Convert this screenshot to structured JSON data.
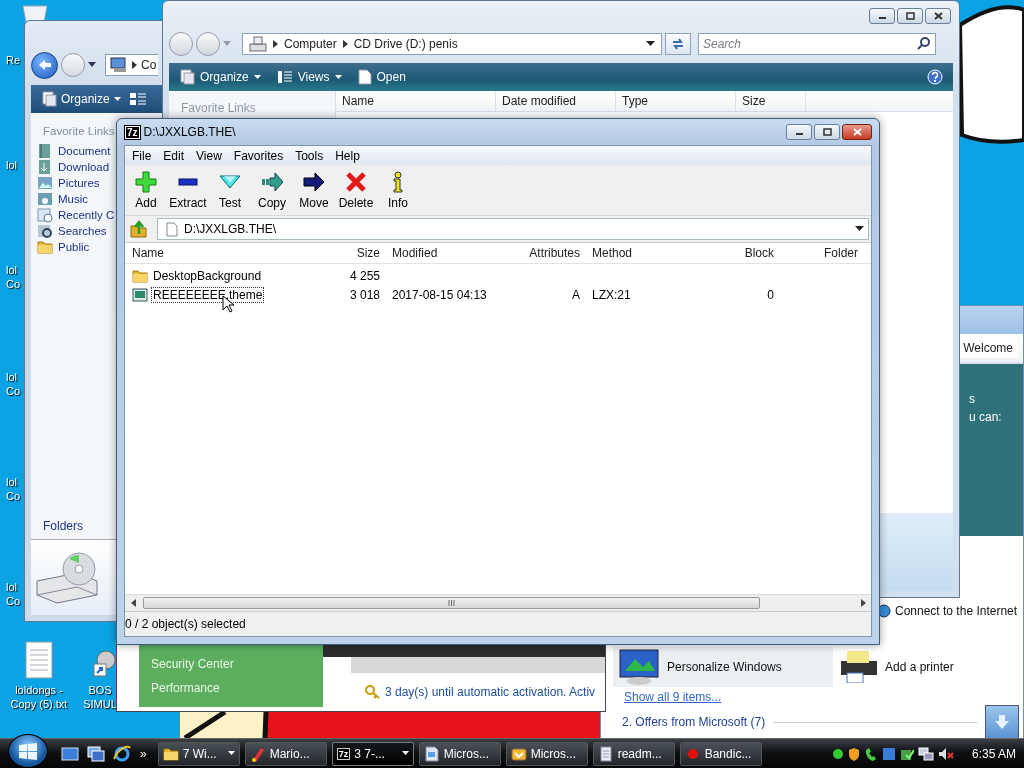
{
  "desktop_icons": [
    {
      "kind": "bin",
      "lines": [
        "Re"
      ]
    },
    {
      "kind": "covered",
      "lines": [
        "lol"
      ]
    },
    {
      "kind": "covered",
      "lines": [
        "lol",
        "Co"
      ]
    },
    {
      "kind": "covered",
      "lines": [
        "lol",
        "Co"
      ]
    },
    {
      "kind": "covered",
      "lines": [
        "lol",
        "Co"
      ]
    },
    {
      "kind": "covered",
      "lines": [
        "lol",
        "Co"
      ]
    },
    {
      "kind": "text-file",
      "lines": [
        "loldongs -",
        "Copy (5).txt"
      ]
    },
    {
      "kind": "shortcut",
      "lines": [
        "BOS",
        "SIMUL"
      ]
    }
  ],
  "welcome_center": {
    "tab": "Welcome",
    "intro": [
      "s",
      "u can:"
    ],
    "tasks": [
      {
        "kind": "internet",
        "label": "Connect to the Internet"
      },
      {
        "kind": "personalize",
        "label": "Personalize Windows"
      },
      {
        "kind": "printer",
        "label": "Add a printer"
      }
    ],
    "show_all": "Show all 9 items...",
    "section": "2. Offers from Microsoft (7)"
  },
  "control_panel": {
    "items": [
      "Security Center",
      "Performance"
    ],
    "activation": "3 day(s) until automatic activation. Activ"
  },
  "back_explorer": {
    "address": "Co",
    "toolbar": [
      "Organize"
    ],
    "favorites_title": "Favorite Links",
    "links": [
      {
        "kind": "documents",
        "label": "Document"
      },
      {
        "kind": "downloads",
        "label": "Download"
      },
      {
        "kind": "pictures",
        "label": "Pictures"
      },
      {
        "kind": "music",
        "label": "Music"
      },
      {
        "kind": "recent",
        "label": "Recently C"
      },
      {
        "kind": "searches",
        "label": "Searches"
      },
      {
        "kind": "public",
        "label": "Public"
      }
    ],
    "folders": "Folders"
  },
  "explorer": {
    "breadcrumb": [
      "Computer",
      "CD Drive (D:) penis"
    ],
    "search": {
      "placeholder": "Search"
    },
    "toolbar": [
      {
        "kind": "organize",
        "label": "Organize",
        "menu": true
      },
      {
        "kind": "views",
        "label": "Views",
        "menu": true
      },
      {
        "kind": "open",
        "label": "Open",
        "menu": false
      }
    ],
    "favorites_title": "Favorite Links",
    "columns": [
      "Name",
      "Date modified",
      "Type",
      "Size"
    ]
  },
  "zip_window": {
    "badge": "7z",
    "title": "D:\\JXXLGB.THE\\",
    "menu": [
      "File",
      "Edit",
      "View",
      "Favorites",
      "Tools",
      "Help"
    ],
    "toolbar": [
      {
        "kind": "add",
        "label": "Add"
      },
      {
        "kind": "extract",
        "label": "Extract"
      },
      {
        "kind": "test",
        "label": "Test"
      },
      {
        "kind": "copy",
        "label": "Copy"
      },
      {
        "kind": "move",
        "label": "Move"
      },
      {
        "kind": "delete",
        "label": "Delete"
      },
      {
        "kind": "info",
        "label": "Info"
      }
    ],
    "path": "D:\\JXXLGB.THE\\",
    "columns": [
      "Name",
      "Size",
      "Modified",
      "Attributes",
      "Method",
      "Block",
      "Folder"
    ],
    "rows": [
      {
        "kind": "folder",
        "name": "DesktopBackground",
        "size": "4 255",
        "focused": false
      },
      {
        "kind": "theme",
        "name": "REEEEEEEE.theme",
        "size": "3 018",
        "modified": "2017-08-15 04:13",
        "attributes": "A",
        "method": "LZX:21",
        "block": "0",
        "focused": true
      }
    ],
    "status": "0 / 2 object(s) selected"
  },
  "taskbar": {
    "overflow": "»",
    "tasks": [
      {
        "kind": "folder",
        "label": "7 Wi...",
        "grouped": true,
        "selected": false
      },
      {
        "kind": "paint",
        "label": "Mario...",
        "grouped": false,
        "selected": false
      },
      {
        "kind": "archive",
        "badge": "7z",
        "label": "3 7-...",
        "grouped": true,
        "selected": true
      },
      {
        "kind": "document",
        "label": "Micros...",
        "grouped": false,
        "selected": false
      },
      {
        "kind": "mail",
        "label": "Micros...",
        "grouped": false,
        "selected": false
      },
      {
        "kind": "notepad",
        "label": "readm...",
        "grouped": false,
        "selected": false
      },
      {
        "kind": "record",
        "label": "Bandic...",
        "grouped": false,
        "selected": false
      }
    ],
    "clock": "6:35 AM"
  }
}
